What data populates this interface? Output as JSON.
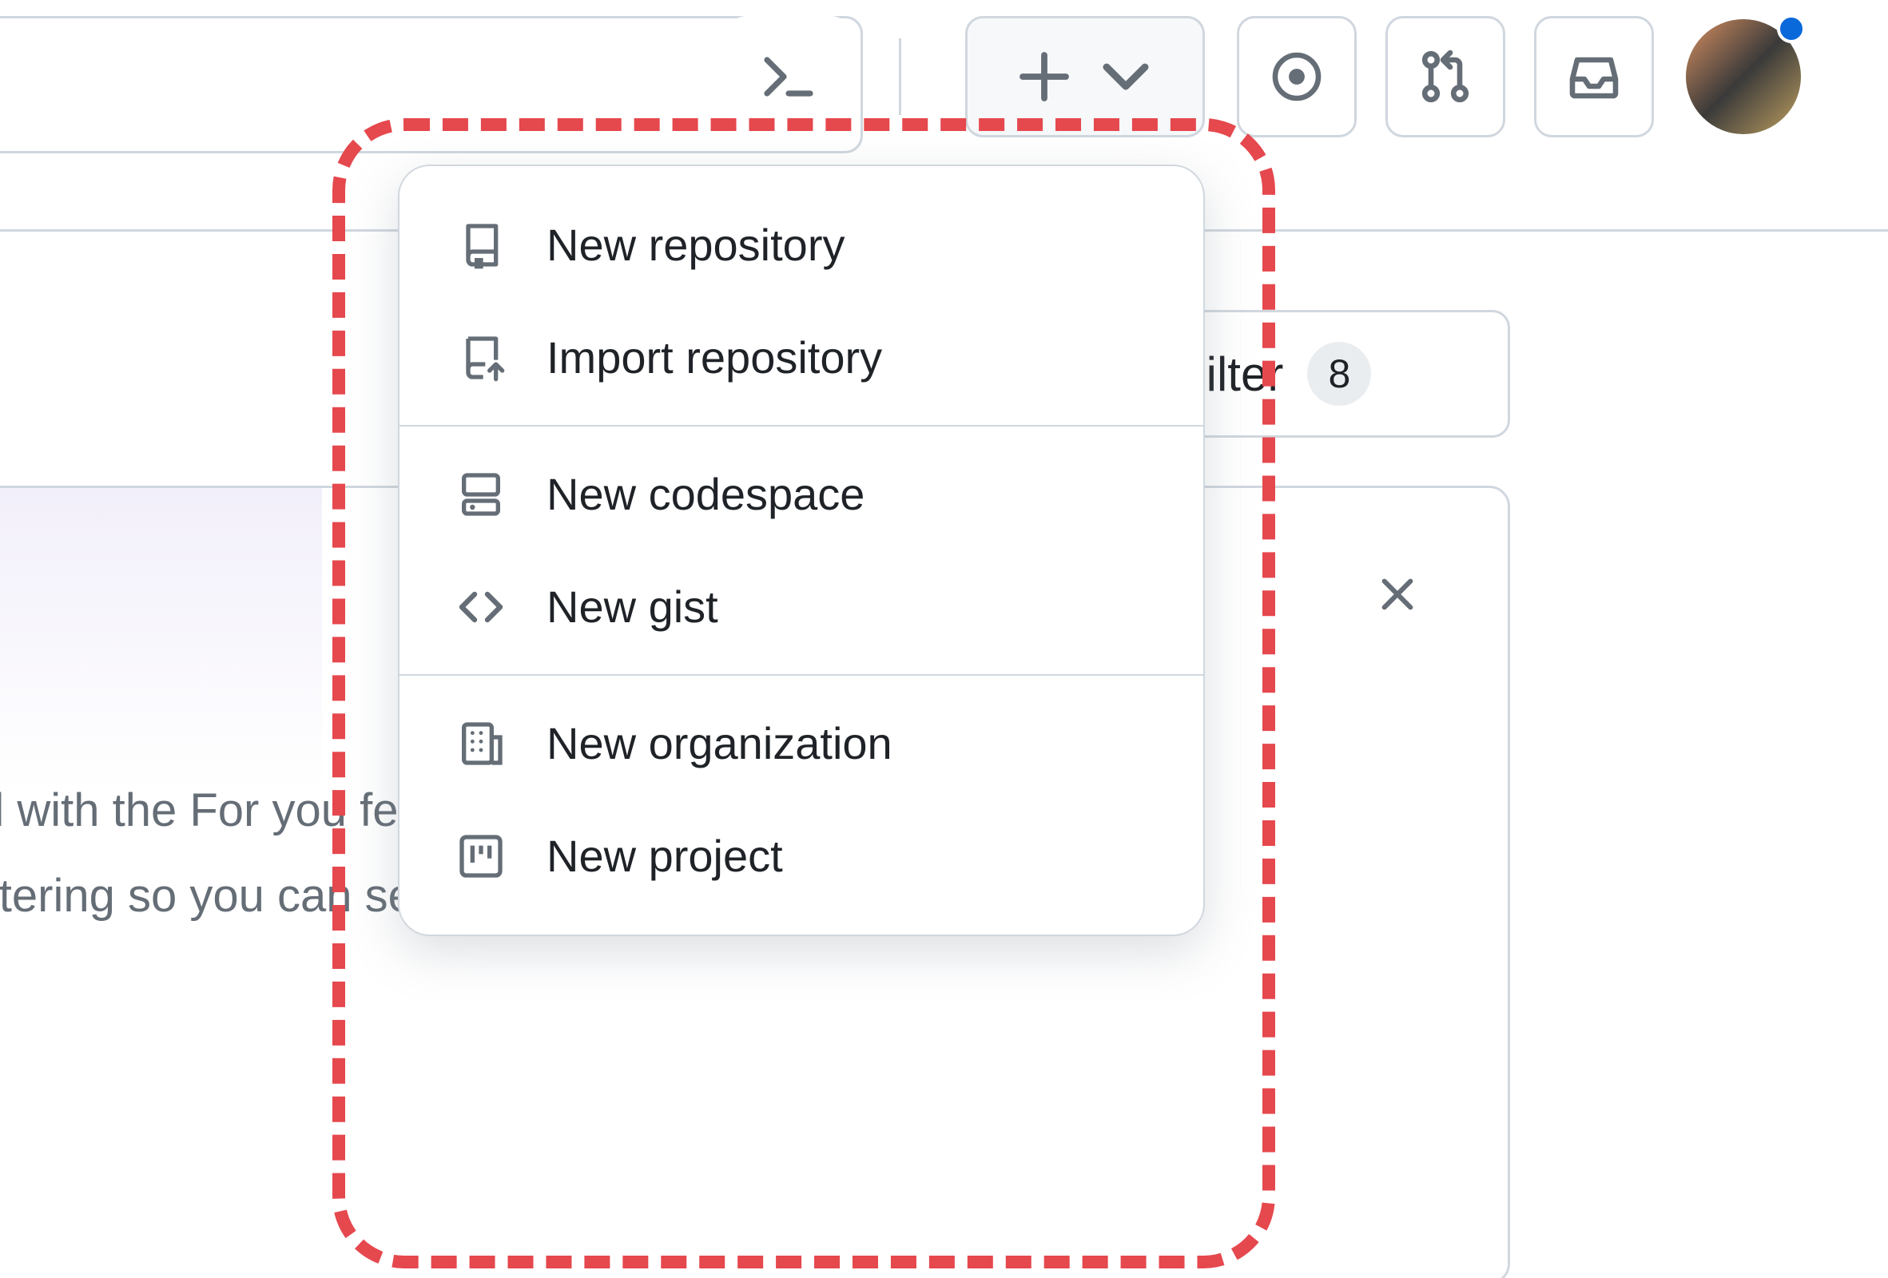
{
  "header": {
    "command_palette_label": "Command palette",
    "create_label": "Create new…",
    "issues_label": "Issues",
    "pull_requests_label": "Pull requests",
    "notifications_label": "Notifications"
  },
  "filter": {
    "label": "Filter",
    "count": "8"
  },
  "card": {
    "body_line1": "d with the For you feed to",
    "body_line2": "iltering so you can see exactly how"
  },
  "create_menu": {
    "groups": [
      [
        {
          "icon": "repo-icon",
          "label": "New repository"
        },
        {
          "icon": "repo-push-icon",
          "label": "Import repository"
        }
      ],
      [
        {
          "icon": "codespaces-icon",
          "label": "New codespace"
        },
        {
          "icon": "code-icon",
          "label": "New gist"
        }
      ],
      [
        {
          "icon": "organization-icon",
          "label": "New organization"
        },
        {
          "icon": "project-icon",
          "label": "New project"
        }
      ]
    ]
  },
  "colors": {
    "border": "#d0d7de",
    "text": "#1f2328",
    "muted": "#656d76",
    "accent": "#0969da",
    "highlight": "#e5484d"
  }
}
